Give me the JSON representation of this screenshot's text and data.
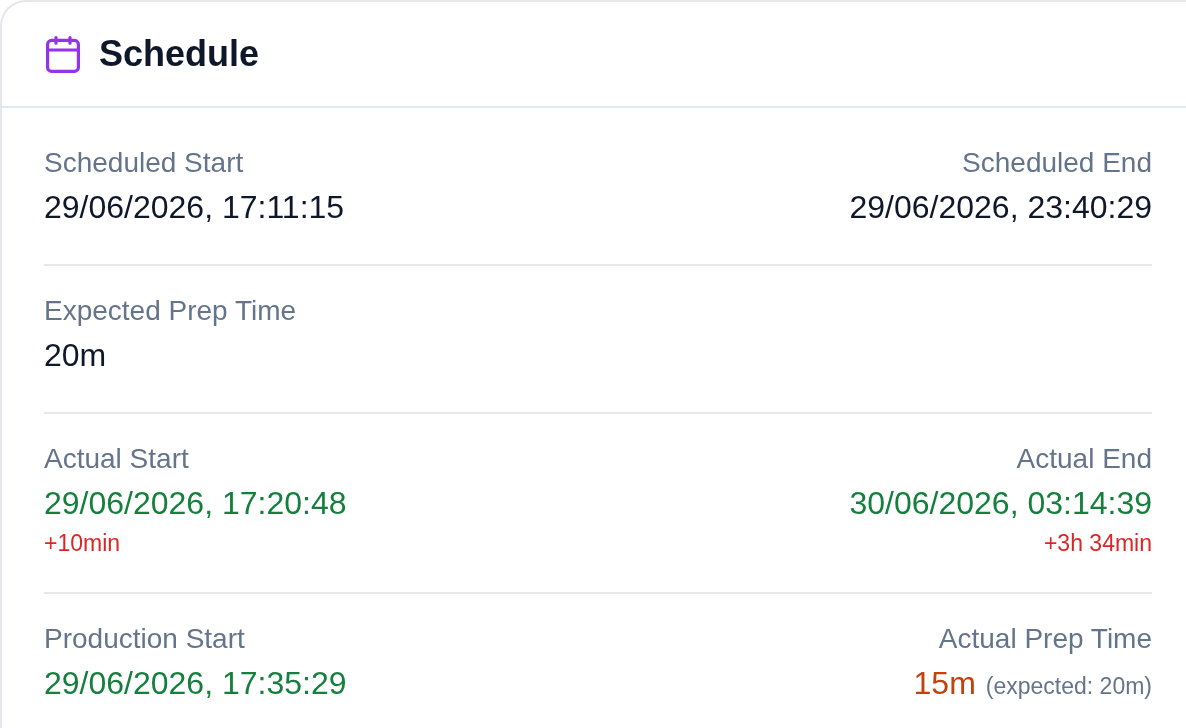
{
  "card": {
    "title": "Schedule"
  },
  "rows": [
    {
      "left": {
        "kind": "neutral",
        "label": "Scheduled Start",
        "value": "29/06/2026, 17:11:15"
      },
      "right": {
        "kind": "neutral",
        "label": "Scheduled End",
        "value": "29/06/2026, 23:40:29"
      }
    },
    {
      "left": {
        "kind": "neutral",
        "label": "Expected Prep Time",
        "value": "20m"
      }
    },
    {
      "left": {
        "kind": "success",
        "label": "Actual Start",
        "value": "29/06/2026, 17:20:48",
        "delta": "+10min"
      },
      "right": {
        "kind": "success",
        "label": "Actual End",
        "value": "30/06/2026, 03:14:39",
        "delta": "+3h 34min"
      }
    },
    {
      "left": {
        "kind": "success",
        "label": "Production Start",
        "value": "29/06/2026, 17:35:29"
      },
      "right": {
        "kind": "warning",
        "label": "Actual Prep Time",
        "value": "15m",
        "note": "(expected: 20m)"
      }
    }
  ]
}
